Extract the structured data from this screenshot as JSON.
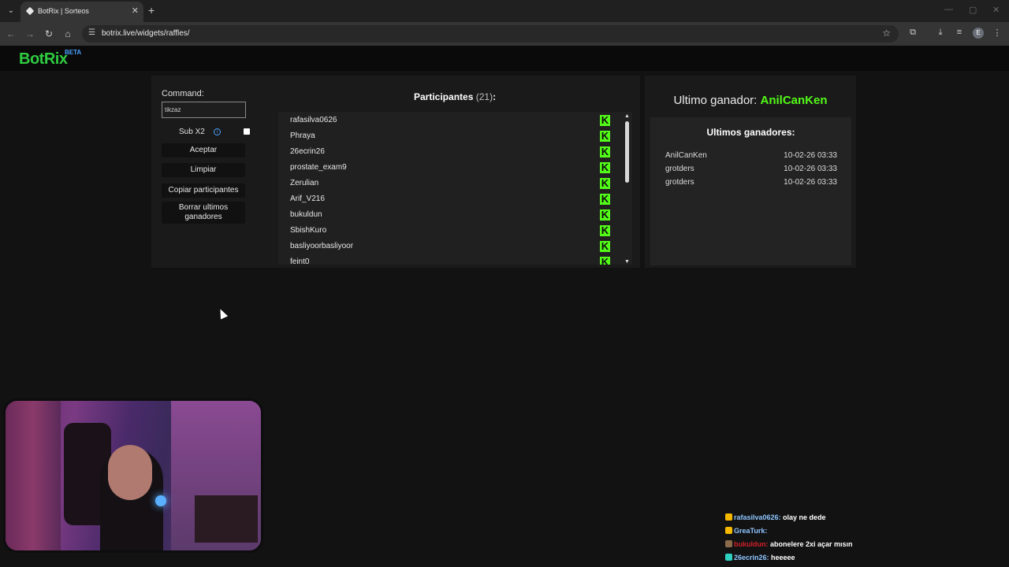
{
  "browser": {
    "tab_title": "BotRix | Sorteos",
    "url": "botrix.live/widgets/raffles/",
    "profile_initial": "E"
  },
  "header": {
    "logo": "BotRix",
    "beta": "BETA"
  },
  "controls": {
    "command_label": "Command:",
    "command_value": "tikzaz",
    "subx2_label": "Sub X2",
    "subx2_checked": false,
    "accept": "Aceptar",
    "clear": "Limpiar",
    "copy": "Copiar participantes",
    "delete_line1": "Borrar ultimos",
    "delete_line2": "ganadores"
  },
  "participants": {
    "title": "Participantes",
    "count": "(21)",
    "colon": ":",
    "platform_letter": "K",
    "items": [
      "rafasilva0626",
      "Phraya",
      "26ecrin26",
      "prostate_exam9",
      "Zerulian",
      "Arif_V216",
      "bukuldun",
      "SbishKuro",
      "basliyoorbasliyoor",
      "feint0"
    ]
  },
  "winner": {
    "label": "Ultimo ganador:",
    "name": "AnilCanKen",
    "history_title": "Ultimos ganadores:",
    "history": [
      {
        "name": "AnilCanKen",
        "time": "10-02-26 03:33"
      },
      {
        "name": "grotders",
        "time": "10-02-26 03:33"
      },
      {
        "name": "grotders",
        "time": "10-02-26 03:33"
      }
    ]
  },
  "chat": [
    {
      "user": "rafasilva0626:",
      "msg": " olay ne dede",
      "user_color": "#8ec5ff",
      "badge_color": "#f5b800"
    },
    {
      "user": "GreaTurk:",
      "msg": " ",
      "user_color": "#8ec5ff",
      "badge_color": "#f5b800"
    },
    {
      "user": "bukuldun:",
      "msg": " abonelere 2xi açar mısın",
      "user_color": "#d0202a",
      "badge_color": "#8a6a4a"
    },
    {
      "user": "26ecrin26:",
      "msg": " heeeee",
      "user_color": "#8ec5ff",
      "badge_color": "#2ed0c0"
    }
  ]
}
